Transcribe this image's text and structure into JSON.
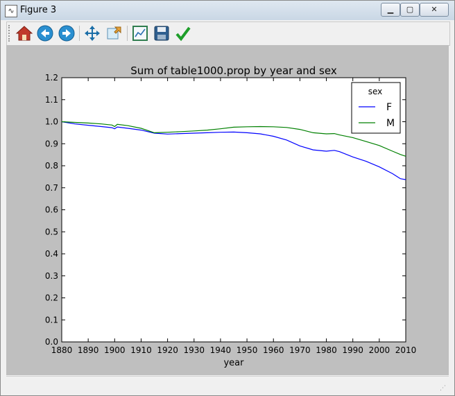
{
  "window": {
    "title": "Figure 3",
    "app_icon": "matplotlib-icon"
  },
  "toolbar": {
    "items": [
      {
        "name": "home-button",
        "icon": "home-icon"
      },
      {
        "name": "back-button",
        "icon": "arrow-left-icon"
      },
      {
        "name": "forward-button",
        "icon": "arrow-right-icon"
      },
      {
        "name": "pan-button",
        "icon": "move-arrows-icon"
      },
      {
        "name": "zoom-button",
        "icon": "zoom-rect-icon"
      },
      {
        "name": "subplots-button",
        "icon": "subplots-icon"
      },
      {
        "name": "save-button",
        "icon": "save-disk-icon"
      },
      {
        "name": "edit-button",
        "icon": "checkmark-icon"
      }
    ]
  },
  "colors": {
    "F": "#0000ff",
    "M": "#008000",
    "figure_bg": "#bfbfbf"
  },
  "chart_data": {
    "type": "line",
    "title": "Sum of table1000.prop by year and sex",
    "xlabel": "year",
    "ylabel": "",
    "xlim": [
      1880,
      2010
    ],
    "ylim": [
      0.0,
      1.2
    ],
    "xticks": [
      1880,
      1890,
      1900,
      1910,
      1920,
      1930,
      1940,
      1950,
      1960,
      1970,
      1980,
      1990,
      2000,
      2010
    ],
    "yticks": [
      0.0,
      0.1,
      0.2,
      0.3,
      0.4,
      0.5,
      0.6,
      0.7,
      0.8,
      0.9,
      1.0,
      1.1,
      1.2
    ],
    "legend": {
      "title": "sex",
      "placement": "top-right"
    },
    "series": [
      {
        "name": "F",
        "x": [
          1880,
          1885,
          1890,
          1895,
          1899,
          1900,
          1901,
          1905,
          1910,
          1915,
          1920,
          1925,
          1930,
          1935,
          1940,
          1945,
          1950,
          1955,
          1960,
          1965,
          1970,
          1975,
          1980,
          1983,
          1985,
          1990,
          1995,
          2000,
          2005,
          2008,
          2010
        ],
        "y": [
          1.0,
          0.99,
          0.984,
          0.978,
          0.973,
          0.968,
          0.976,
          0.97,
          0.962,
          0.948,
          0.944,
          0.946,
          0.948,
          0.95,
          0.952,
          0.953,
          0.95,
          0.945,
          0.934,
          0.917,
          0.89,
          0.872,
          0.866,
          0.87,
          0.864,
          0.84,
          0.82,
          0.795,
          0.764,
          0.741,
          0.737
        ]
      },
      {
        "name": "M",
        "x": [
          1880,
          1885,
          1890,
          1895,
          1899,
          1900,
          1901,
          1905,
          1910,
          1915,
          1920,
          1925,
          1930,
          1935,
          1940,
          1945,
          1950,
          1955,
          1960,
          1965,
          1970,
          1975,
          1980,
          1983,
          1985,
          1990,
          1995,
          2000,
          2005,
          2008,
          2010
        ],
        "y": [
          1.0,
          0.997,
          0.994,
          0.99,
          0.985,
          0.978,
          0.988,
          0.982,
          0.97,
          0.95,
          0.952,
          0.955,
          0.958,
          0.962,
          0.968,
          0.975,
          0.977,
          0.978,
          0.977,
          0.974,
          0.965,
          0.95,
          0.945,
          0.946,
          0.94,
          0.928,
          0.91,
          0.892,
          0.866,
          0.851,
          0.843
        ]
      }
    ]
  }
}
